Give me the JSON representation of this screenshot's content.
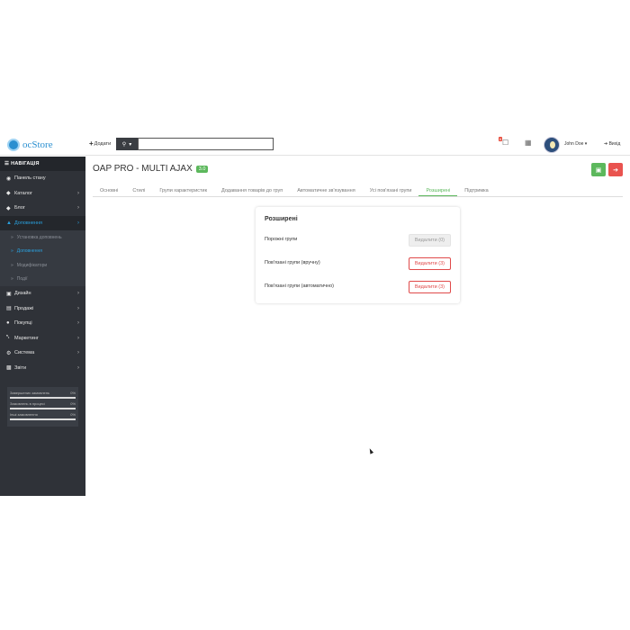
{
  "header": {
    "logo_text": "ocStore",
    "add_label": "Додати",
    "search_placeholder": "",
    "notifications_count": "6",
    "user_name": "John Doe",
    "logout_label": "Вихід"
  },
  "sidebar": {
    "title": "НАВІГАЦІЯ",
    "items": [
      {
        "label": "Панель стану",
        "icon": "dashboard-icon"
      },
      {
        "label": "Каталог",
        "icon": "tag-icon"
      },
      {
        "label": "Блог",
        "icon": "tag-icon"
      },
      {
        "label": "Доповнення",
        "icon": "puzzle-icon"
      },
      {
        "label": "Дизайн",
        "icon": "monitor-icon"
      },
      {
        "label": "Продажі",
        "icon": "cart-icon"
      },
      {
        "label": "Покупці",
        "icon": "user-icon"
      },
      {
        "label": "Маркетинг",
        "icon": "share-icon"
      },
      {
        "label": "Система",
        "icon": "gear-icon"
      },
      {
        "label": "Звіти",
        "icon": "chart-icon"
      }
    ],
    "subitems": [
      {
        "label": "Установка доповнень"
      },
      {
        "label": "Доповнення"
      },
      {
        "label": "Модифікатори"
      },
      {
        "label": "Події"
      }
    ],
    "stats": [
      {
        "label": "Завершених замовлень",
        "value": "0%"
      },
      {
        "label": "Замовлень в процесі",
        "value": "0%"
      },
      {
        "label": "Інші замовлення",
        "value": "0%"
      }
    ]
  },
  "main": {
    "title": "OAP PRO - MULTI AJAX",
    "version": "3.0",
    "tabs": [
      {
        "label": "Основні"
      },
      {
        "label": "Стилі"
      },
      {
        "label": "Групи характеристик"
      },
      {
        "label": "Додавання товарів до груп"
      },
      {
        "label": "Автоматичне зв'язування"
      },
      {
        "label": "Усі пов'язані групи"
      },
      {
        "label": "Розширені"
      },
      {
        "label": "Підтримка"
      }
    ],
    "panel": {
      "title": "Розширені",
      "rows": [
        {
          "label": "Порожні групи",
          "button": "Видалити (0)"
        },
        {
          "label": "Пов'язані групи (вручну)",
          "button": "Видалити (3)"
        },
        {
          "label": "Пов'язані групи (автоматично)",
          "button": "Видалити (3)"
        }
      ]
    }
  },
  "colors": {
    "accent_green": "#5cb85c",
    "danger_red": "#e04a4a",
    "sidebar_bg": "#2f3238",
    "link_blue": "#2aa2e0"
  }
}
